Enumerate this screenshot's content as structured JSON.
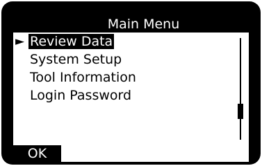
{
  "screen": {
    "title": "Main Menu",
    "menu": {
      "selected_index": 0,
      "selection_marker_icon": "pointer-right-icon",
      "items": [
        {
          "label": "Review Data"
        },
        {
          "label": "System Setup"
        },
        {
          "label": "Tool Information"
        },
        {
          "label": "Login Password"
        }
      ]
    },
    "softkey": {
      "ok_label": "OK"
    }
  }
}
